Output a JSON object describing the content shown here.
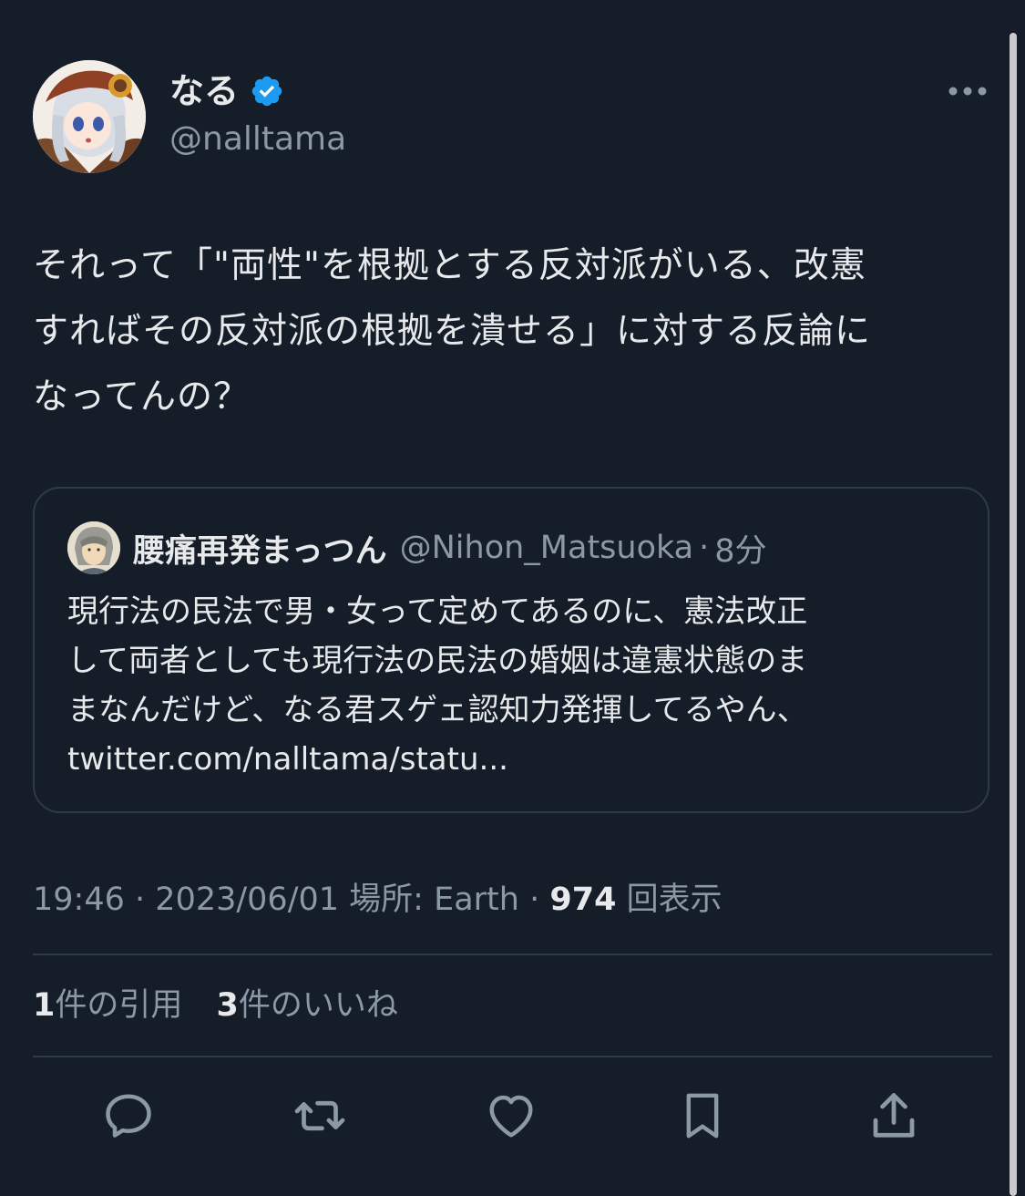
{
  "tweet": {
    "display_name": "なる",
    "handle": "@nalltama",
    "text": "それって「\"両性\"を根拠とする反対派がいる、改憲\nすればその反対派の根拠を潰せる」に対する反論に\nなってんの？",
    "time": "19:46",
    "date": "2023/06/01",
    "location_label": "場所: Earth",
    "views_count": "974",
    "views_label": "回表示",
    "separator": "·"
  },
  "quoted": {
    "display_name": "腰痛再発まっつん",
    "handle": "@Nihon_Matsuoka",
    "separator": "·",
    "time": "8分",
    "text": "現行法の民法で男・女って定めてあるのに、憲法改正\nして両者としても現行法の民法の婚姻は違憲状態のま\nまなんだけど、なる君スゲェ認知力発揮してるやん、\ntwitter.com/nalltama/statu..."
  },
  "stats": {
    "quotes_count": "1",
    "quotes_label": "件の引用",
    "likes_count": "3",
    "likes_label": "件のいいね"
  },
  "actions": [
    "reply-icon",
    "retweet-icon",
    "like-icon",
    "bookmark-icon",
    "share-icon"
  ],
  "colors": {
    "background": "#151d29",
    "text_primary": "#e7e9ea",
    "text_secondary": "#8b98a5",
    "border": "#2f3a47",
    "verified": "#1d9bf0"
  }
}
